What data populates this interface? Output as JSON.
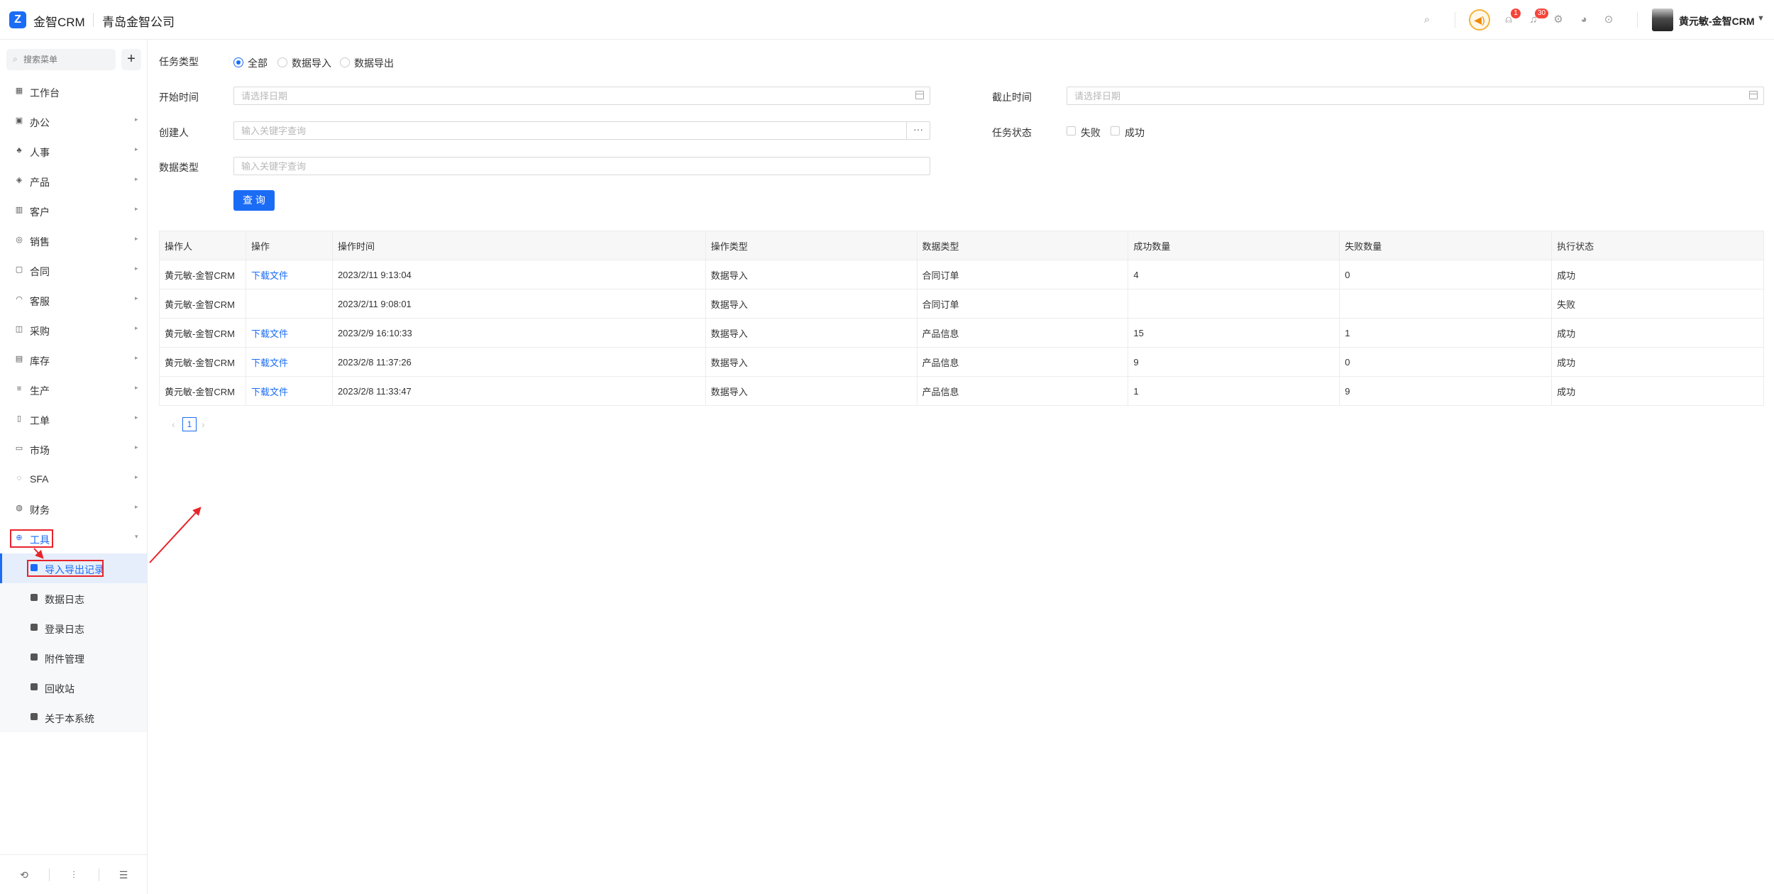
{
  "header": {
    "app_name": "金智CRM",
    "company": "青岛金智公司",
    "message_badge": "1",
    "notification_badge": "30",
    "user_name": "黄元敏-金智CRM"
  },
  "sidebar": {
    "search_placeholder": "搜索菜单",
    "add_label": "+",
    "items": [
      {
        "label": "工作台",
        "icon": "dashboard-icon",
        "has_arrow": false
      },
      {
        "label": "办公",
        "icon": "office-icon",
        "has_arrow": true
      },
      {
        "label": "人事",
        "icon": "people-icon",
        "has_arrow": true
      },
      {
        "label": "产品",
        "icon": "product-icon",
        "has_arrow": true
      },
      {
        "label": "客户",
        "icon": "customer-icon",
        "has_arrow": true
      },
      {
        "label": "销售",
        "icon": "sales-icon",
        "has_arrow": true
      },
      {
        "label": "合同",
        "icon": "contract-icon",
        "has_arrow": true
      },
      {
        "label": "客服",
        "icon": "service-icon",
        "has_arrow": true
      },
      {
        "label": "采购",
        "icon": "purchase-icon",
        "has_arrow": true
      },
      {
        "label": "库存",
        "icon": "inventory-icon",
        "has_arrow": true
      },
      {
        "label": "生产",
        "icon": "production-icon",
        "has_arrow": true
      },
      {
        "label": "工单",
        "icon": "work-order-icon",
        "has_arrow": true
      },
      {
        "label": "市场",
        "icon": "market-icon",
        "has_arrow": true
      },
      {
        "label": "SFA",
        "icon": "sfa-icon",
        "has_arrow": true
      },
      {
        "label": "财务",
        "icon": "finance-icon",
        "has_arrow": true
      },
      {
        "label": "工具",
        "icon": "tools-icon",
        "has_arrow": true
      }
    ],
    "tools_submenu": [
      {
        "label": "导入导出记录",
        "active": true
      },
      {
        "label": "数据日志",
        "active": false
      },
      {
        "label": "登录日志",
        "active": false
      },
      {
        "label": "附件管理",
        "active": false
      },
      {
        "label": "回收站",
        "active": false
      },
      {
        "label": "关于本系统",
        "active": false
      }
    ]
  },
  "filters": {
    "task_type_label": "任务类型",
    "task_type_options": [
      "全部",
      "数据导入",
      "数据导出"
    ],
    "task_type_selected": "全部",
    "start_time_label": "开始时间",
    "start_time_placeholder": "请选择日期",
    "end_time_label": "截止时间",
    "end_time_placeholder": "请选择日期",
    "creator_label": "创建人",
    "creator_placeholder": "输入关键字查询",
    "creator_button": "···",
    "task_status_label": "任务状态",
    "task_status_options": [
      "失败",
      "成功"
    ],
    "data_type_label": "数据类型",
    "data_type_placeholder": "输入关键字查询",
    "query_button": "查 询"
  },
  "table": {
    "columns": [
      "操作人",
      "操作",
      "操作时间",
      "操作类型",
      "数据类型",
      "成功数量",
      "失败数量",
      "执行状态"
    ],
    "rows": [
      [
        "黄元敏-金智CRM",
        "下载文件",
        "2023/2/11 9:13:04",
        "数据导入",
        "合同订单",
        "4",
        "0",
        "成功"
      ],
      [
        "黄元敏-金智CRM",
        "",
        "2023/2/11 9:08:01",
        "数据导入",
        "合同订单",
        "",
        "",
        "失败"
      ],
      [
        "黄元敏-金智CRM",
        "下载文件",
        "2023/2/9 16:10:33",
        "数据导入",
        "产品信息",
        "15",
        "1",
        "成功"
      ],
      [
        "黄元敏-金智CRM",
        "下载文件",
        "2023/2/8 11:37:26",
        "数据导入",
        "产品信息",
        "9",
        "0",
        "成功"
      ],
      [
        "黄元敏-金智CRM",
        "下载文件",
        "2023/2/8 11:33:47",
        "数据导入",
        "产品信息",
        "1",
        "9",
        "成功"
      ]
    ]
  },
  "pagination": {
    "prev": "‹",
    "current": "1",
    "next": "›"
  },
  "colors": {
    "accent": "#1b6cf5",
    "annotation_red": "#e8242a",
    "badge": "#f5453b"
  }
}
